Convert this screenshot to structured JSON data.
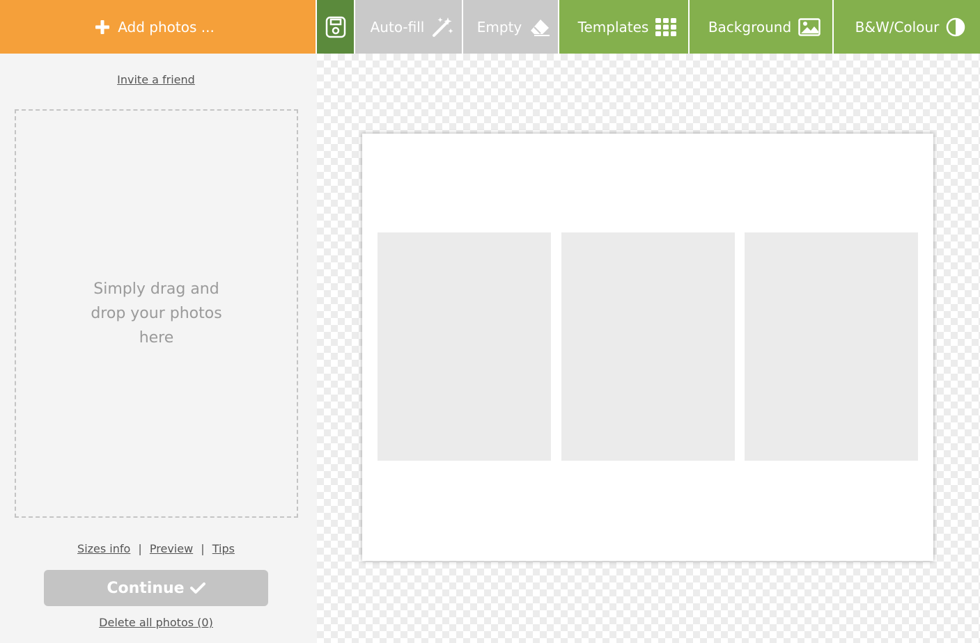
{
  "toolbar": {
    "add_photos_label": "Add photos ...",
    "autofill_label": "Auto-fill",
    "empty_label": "Empty",
    "templates_label": "Templates",
    "background_label": "Background",
    "bw_label": "B&W/Colour",
    "icons": {
      "add": "plus-icon",
      "save": "save-icon",
      "autofill": "magic-wand-icon",
      "empty": "eraser-icon",
      "templates": "grid-icon",
      "background": "image-icon",
      "bw": "contrast-icon"
    },
    "colors": {
      "add": "#f5a03a",
      "save": "#5b8a3c",
      "disabled": "#c9c9c9",
      "green": "#84b04d"
    }
  },
  "sidebar": {
    "invite_label": "Invite a friend",
    "drop_text": "Simply drag and drop your photos here",
    "links": {
      "sizes_info": "Sizes info",
      "preview": "Preview",
      "tips": "Tips",
      "separator": "|"
    },
    "continue_label": "Continue",
    "delete_all_label": "Delete all photos (0)"
  },
  "canvas": {
    "slots": 3
  }
}
